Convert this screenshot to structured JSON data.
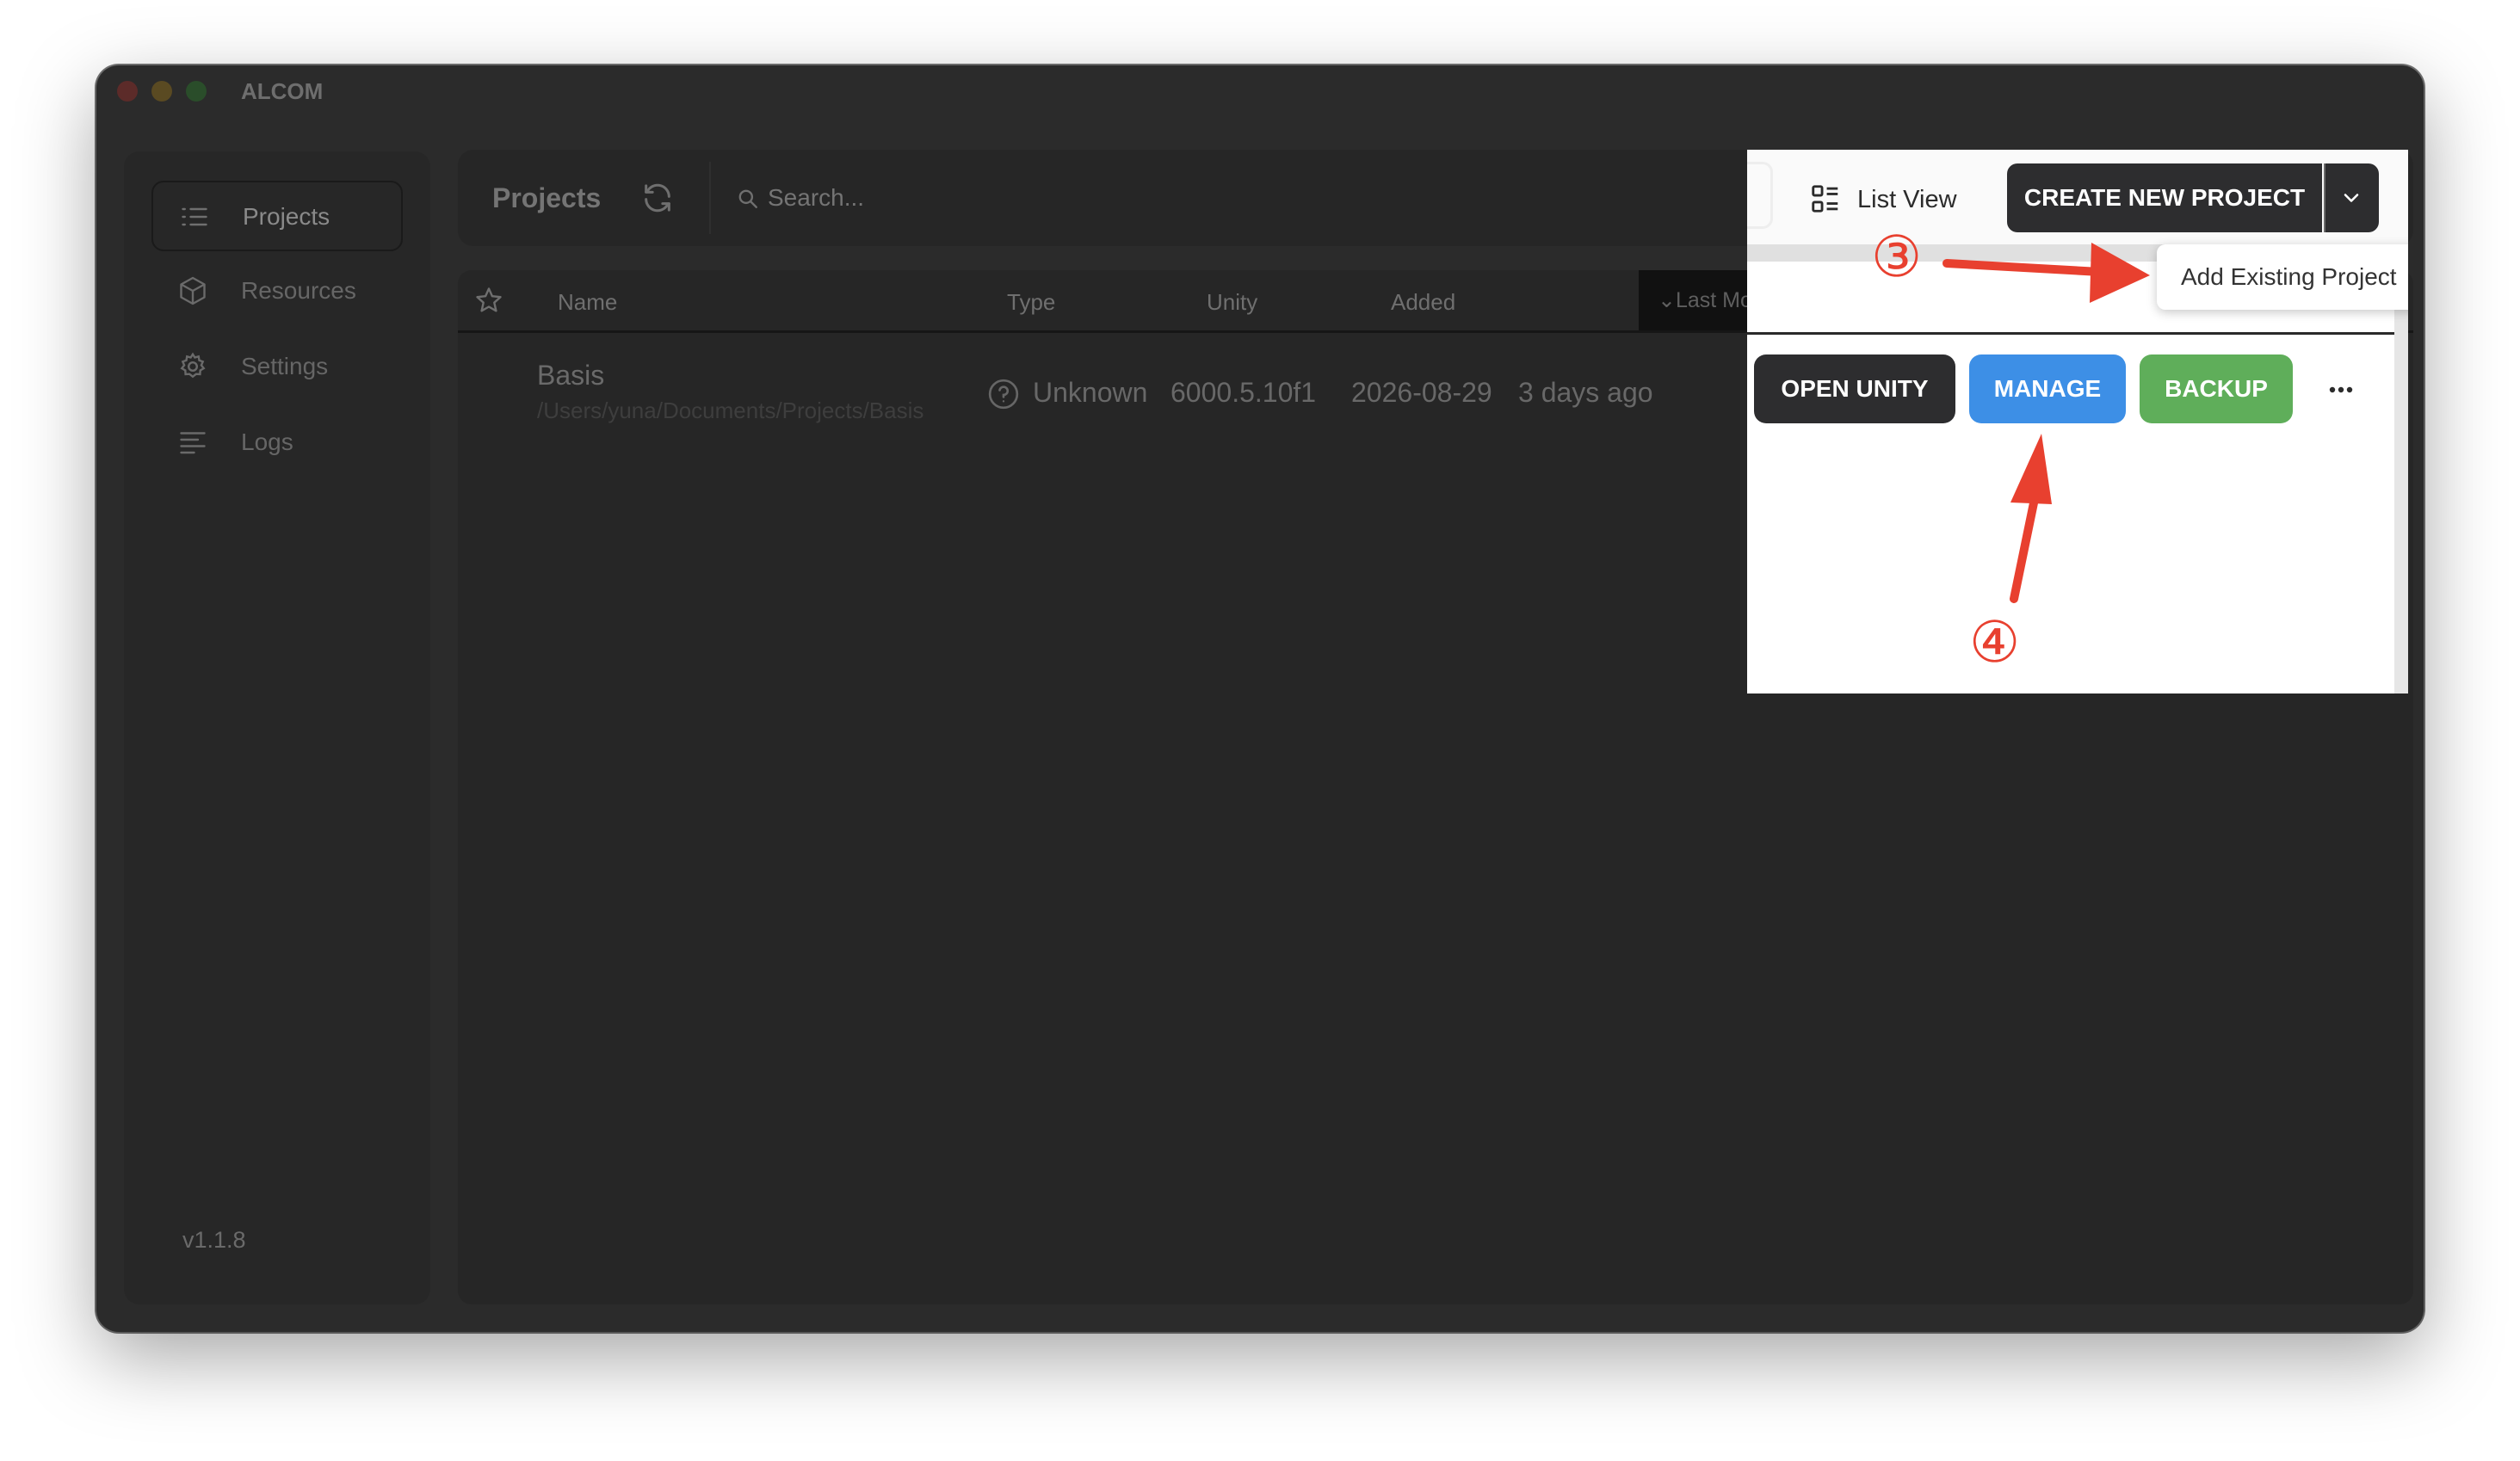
{
  "window": {
    "title": "ALCOM"
  },
  "sidebar": {
    "items": [
      {
        "label": "Projects",
        "icon": "list-icon",
        "active": true
      },
      {
        "label": "Resources",
        "icon": "cube-icon",
        "active": false
      },
      {
        "label": "Settings",
        "icon": "gear-icon",
        "active": false
      },
      {
        "label": "Logs",
        "icon": "logs-icon",
        "active": false
      }
    ],
    "version": "v1.1.8"
  },
  "header": {
    "title": "Projects",
    "search_placeholder": "Search...",
    "view_label": "List View",
    "create_label": "CREATE NEW PROJECT",
    "dropdown_item": "Add Existing Project"
  },
  "table": {
    "columns": [
      "Name",
      "Type",
      "Unity",
      "Added",
      "Last Modified"
    ],
    "sorted_column": "Last Modified",
    "rows": [
      {
        "name": "Basis",
        "path": "/Users/yuna/Documents/Projects/Basis",
        "type": "Unknown",
        "unity": "6000.5.10f1",
        "added": "2026-08-29",
        "modified": "3 days ago"
      }
    ]
  },
  "actions": {
    "open_label": "OPEN UNITY",
    "manage_label": "MANAGE",
    "backup_label": "BACKUP"
  },
  "annotations": {
    "step3": "③",
    "step4": "④",
    "arrow_color": "#e8402f"
  },
  "colors": {
    "manage": "#3d8fe6",
    "backup": "#5fae5a",
    "dark_button": "#2d2d2f",
    "window_bg": "#2b2b2b"
  }
}
